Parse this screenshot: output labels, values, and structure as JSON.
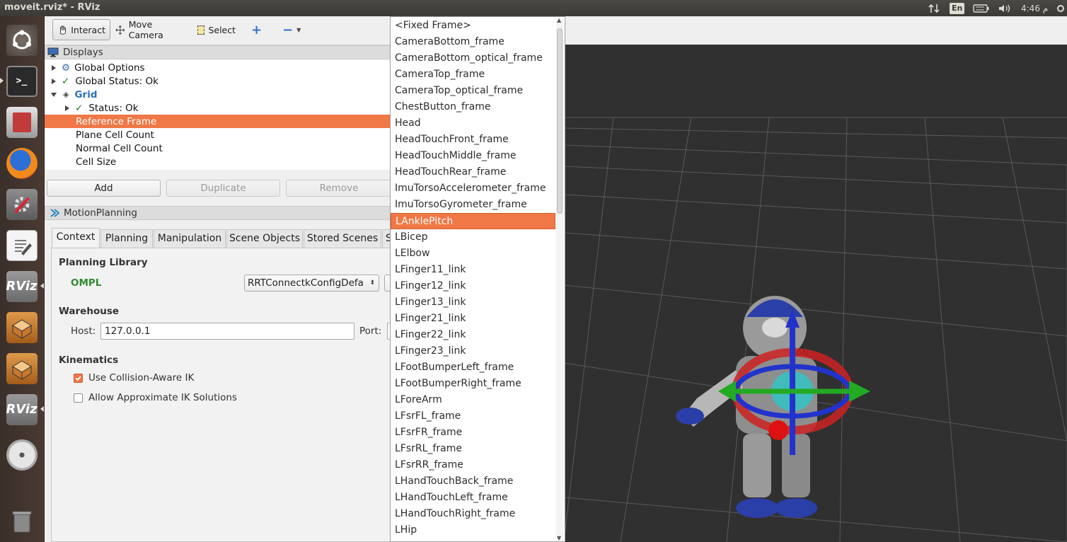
{
  "window": {
    "title": "moveit.rviz* - RViz"
  },
  "tray": {
    "lang": "En",
    "time": "4:46 م"
  },
  "toolbar": {
    "interact_label": "Interact",
    "move_camera_label": "Move Camera",
    "select_label": "Select"
  },
  "displays": {
    "title": "Displays",
    "tree": {
      "global_options": "Global Options",
      "global_status": "Global Status: Ok",
      "grid": "Grid",
      "status": "Status: Ok",
      "reference_frame": "Reference Frame",
      "plane_cell_count": "Plane Cell Count",
      "normal_cell_count": "Normal Cell Count",
      "cell_size": "Cell Size"
    },
    "buttons": {
      "add": "Add",
      "duplicate": "Duplicate",
      "remove": "Remove"
    }
  },
  "motion_planning": {
    "title": "MotionPlanning",
    "tabs": [
      "Context",
      "Planning",
      "Manipulation",
      "Scene Objects",
      "Stored Scenes",
      "S"
    ],
    "planning_library_label": "Planning Library",
    "planning_library_value": "OMPL",
    "planner_combo": "RRTConnectkConfigDefa",
    "warehouse_label": "Warehouse",
    "host_label": "Host:",
    "host_value": "127.0.0.1",
    "port_label": "Port:",
    "kinematics_label": "Kinematics",
    "use_collision_ik": "Use Collision-Aware IK",
    "allow_approx_ik": "Allow Approximate IK Solutions",
    "use_collision_ik_checked": true,
    "allow_approx_ik_checked": false
  },
  "dropdown": {
    "items": [
      "<Fixed Frame>",
      "CameraBottom_frame",
      "CameraBottom_optical_frame",
      "CameraTop_frame",
      "CameraTop_optical_frame",
      "ChestButton_frame",
      "Head",
      "HeadTouchFront_frame",
      "HeadTouchMiddle_frame",
      "HeadTouchRear_frame",
      "ImuTorsoAccelerometer_frame",
      "ImuTorsoGyrometer_frame",
      "LAnklePitch",
      "LBicep",
      "LElbow",
      "LFinger11_link",
      "LFinger12_link",
      "LFinger13_link",
      "LFinger21_link",
      "LFinger22_link",
      "LFinger23_link",
      "LFootBumperLeft_frame",
      "LFootBumperRight_frame",
      "LForeArm",
      "LFsrFL_frame",
      "LFsrFR_frame",
      "LFsrRL_frame",
      "LFsrRR_frame",
      "LHandTouchBack_frame",
      "LHandTouchLeft_frame",
      "LHandTouchRight_frame",
      "LHip"
    ],
    "selected": "LAnklePitch"
  },
  "colors": {
    "selection": "#f07746",
    "status_ok": "#1a7a1a",
    "ompl": "#2f8a2f",
    "grid_label": "#2a6fc0"
  }
}
